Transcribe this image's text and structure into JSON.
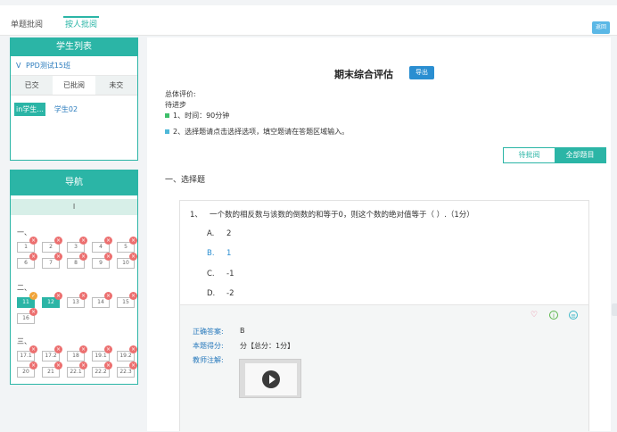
{
  "topbar": {
    "tabs": [
      "单题批阅",
      "按人批阅"
    ],
    "back_label": "返回"
  },
  "student_panel": {
    "title": "学生列表",
    "class_name": "PPD测试15班",
    "status_tabs": [
      "已交",
      "已批阅",
      "未交"
    ],
    "students": [
      "in学生...",
      "学生02"
    ]
  },
  "nav_panel": {
    "title": "导航",
    "roman": "I",
    "sections": [
      {
        "label": "一、",
        "items": [
          "1",
          "2",
          "3",
          "4",
          "5",
          "6",
          "7",
          "8",
          "9",
          "10"
        ]
      },
      {
        "label": "二、",
        "items": [
          "11",
          "12",
          "13",
          "14",
          "15",
          "16"
        ]
      },
      {
        "label": "三、",
        "items": [
          "17.1",
          "17.2",
          "18",
          "19.1",
          "19.2",
          "20",
          "21",
          "22.1",
          "22.2",
          "22.3"
        ]
      }
    ]
  },
  "main": {
    "title": "期末综合评估",
    "export_label": "导出",
    "overall_label": "总体评价:",
    "overall_value": "待进步",
    "note1": "1、时间：90分钟",
    "note2": "2、选择题请点击选择选项，填空题请在答题区域输入。",
    "filters": [
      "待批阅",
      "全部题目"
    ],
    "section": "一、选择题",
    "question": {
      "number": "1、",
      "text": "一个数的相反数与该数的倒数的和等于0，则这个数的绝对值等于（    ）.（1分）",
      "options": [
        {
          "letter": "A.",
          "text": "2"
        },
        {
          "letter": "B.",
          "text": "1"
        },
        {
          "letter": "C.",
          "text": "-1"
        },
        {
          "letter": "D.",
          "text": "-2"
        }
      ],
      "answer_label": "正确答案:",
      "answer_value": "B",
      "score_label": "本题得分:",
      "score_value": "分【总分：1分】",
      "teacher_label": "教师注解:"
    }
  },
  "colors": {
    "accent": "#2bb5a6",
    "link": "#2a7bbd",
    "wrong": "#ec6f6f"
  }
}
